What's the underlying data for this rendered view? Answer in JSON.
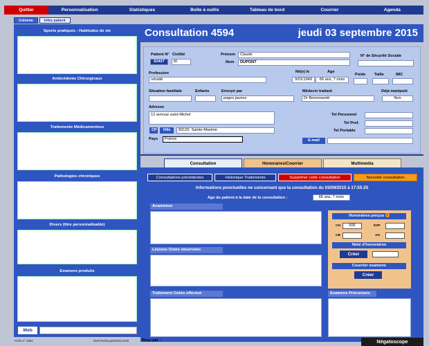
{
  "menu": {
    "quitter": "Quitter",
    "personnalisation": "Personnalisation",
    "statistiques": "Statistiques",
    "boite": "Boîte à outils",
    "tableau": "Tableau de bord",
    "courrier": "Courrier",
    "agenda": "Agenda"
  },
  "subtabs": {
    "colonne": "Colonne",
    "infos": "Infos patient"
  },
  "left": {
    "sports": "Sports pratiqués - Habitudes de vie",
    "antecedents": "Antécédents Chirurgicaux",
    "traitements": "Traitements Médicamenteux",
    "pathologies": "Pathologies chroniques",
    "divers": "Divers (titre personnalisable)",
    "examens": "Examens produits",
    "web": "Web"
  },
  "footer": {
    "fiche": "Fiche n° 4594",
    "user": "dUPONTclaude09/01/1949",
    "recu": "Reçu par :"
  },
  "header": {
    "title": "Consultation  4594",
    "date": "jeudi 03 septembre 2015"
  },
  "patient": {
    "num_label": "Patient N°",
    "num": "62437",
    "civ_label": "Civilité",
    "civ": "M.",
    "prenom_label": "Prénom",
    "prenom": "Claude",
    "nom_label": "Nom",
    "nom": "DUPONT",
    "secu_label": "N° de Sécurité Sociale",
    "prof_label": "Profession",
    "prof": "retraité",
    "ne_label": "Né(e) le",
    "ne": "9/01/1949",
    "age_label": "Age",
    "age": "66 ans, 7 mois",
    "poids": "Poids",
    "taille": "Taille",
    "imc": "IMC",
    "situation": "Situation familiale",
    "enfants": "Enfants",
    "envoye_label": "Envoyé par",
    "envoye": "pages jaunes",
    "medecin_label": "Médecin traitant",
    "medecin": "Dr Bonnesanté",
    "deja": "Déjà manipulé",
    "deja_val": "Non",
    "adresse_label": "Adresse",
    "adresse": "12 avenue saint-Michel",
    "cp": "CP",
    "ville": "Ville",
    "cp_val": "83120",
    "ville_val": "Sainte-Maxime",
    "pays_label": "Pays",
    "pays": "France",
    "tel_perso": "Tel Personnel",
    "tel_prof": "Tel Prof.",
    "tel_port": "Tel Portable",
    "email": "E-mail"
  },
  "tabs": {
    "consultation": "Consultation",
    "honoraires": "Honoraires/Courrier",
    "multimedia": "Multimédia"
  },
  "buttons": {
    "precedentes": "Consultations précédentes",
    "historique": "Historique Traitements",
    "supprimer": "Supprimer cette consultation",
    "nouvelle": "Nouvelle consultation"
  },
  "info": {
    "line1": "Informations ponctuelles ne concernant que la consultation du 03/09/2015 à 17:55:25",
    "age_label": "Age du patient à la date de la consultation :",
    "age": "66 ans, 7 mois"
  },
  "sections": {
    "anamnese": "Anamnèse",
    "lesions": "Lésions Ostéo observées",
    "traitement": "Traitement Ostéo effectué",
    "examens": "Examens Préconisés"
  },
  "honoraires": {
    "title": "Honoraires perçus",
    "ch": "CH",
    "ch_val": "50€",
    "esp": "ESP",
    "cb": "CB",
    "ag": "AG",
    "note": "Note d'honoraires",
    "creer": "Créer",
    "courrier": "Courrier examens",
    "creer2": "Créer"
  },
  "negatoscope": "Négatoscope",
  "colors": {
    "menu": "#1f3a93",
    "accent_red": "#d10000",
    "panel": "#2f55c0",
    "card": "#b8c9ee",
    "orange": "#f1c38c"
  }
}
